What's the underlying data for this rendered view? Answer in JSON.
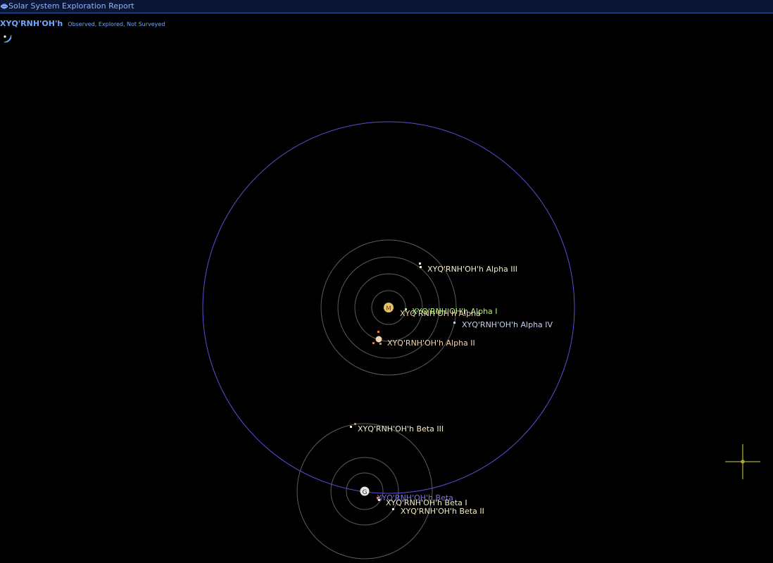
{
  "window": {
    "title": "Solar System Exploration Report"
  },
  "system": {
    "name": "XYQ'RNH'OH'h",
    "status": "Observed, Explored, Not Surveyed"
  },
  "stars": {
    "alpha": {
      "label": "XYQ'RNH'OH'h Alpha",
      "spectral_glyph": "M",
      "color": "#e6c36b"
    },
    "beta": {
      "label": "XYQ'RNH'OH'h Beta",
      "spectral_glyph": "G",
      "color": "#e8e8e8"
    }
  },
  "planets": {
    "alpha_1": {
      "label": "XYQ'RNH'OH'h Alpha I",
      "color": "#b6f07a"
    },
    "alpha_2": {
      "label": "XYQ'RNH'OH'h Alpha II",
      "color": "#f2d4b0"
    },
    "alpha_3": {
      "label": "XYQ'RNH'OH'h Alpha III",
      "color": "#f2ebc7"
    },
    "alpha_4": {
      "label": "XYQ'RNH'OH'h Alpha IV",
      "color": "#c4cff0"
    },
    "beta_1": {
      "label": "XYQ'RNH'OH'h Beta I",
      "color": "#f2ebc7"
    },
    "beta_2": {
      "label": "XYQ'RNH'OH'h Beta II",
      "color": "#f2ebc7"
    },
    "beta_3": {
      "label": "XYQ'RNH'OH'h Beta III",
      "color": "#f2ebc7"
    }
  },
  "colors": {
    "companion_orbit": "#5a4fd6",
    "orbit_ring": "#5c5c5c",
    "beta_star_label": "#7c74d9",
    "moon": "#e07a30",
    "crosshair": "#d8d830"
  }
}
